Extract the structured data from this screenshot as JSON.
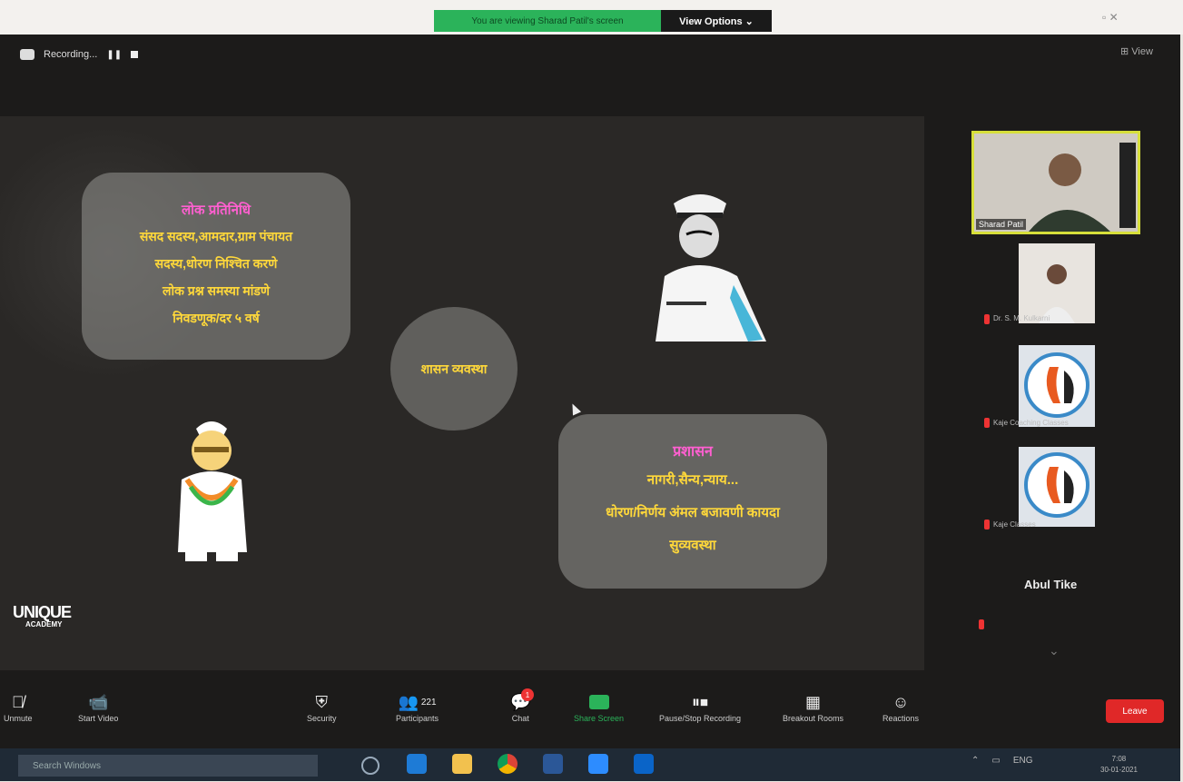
{
  "banner": {
    "sharing_msg": "You are viewing Sharad Patil's screen",
    "view_options": "View Options ⌄"
  },
  "meeting": {
    "recording_label": "Recording..."
  },
  "slide": {
    "bubble1": [
      "लोक प्रतिनिधि",
      "संसद सदस्य,आमदार,ग्राम पंचायत",
      "सदस्य,धोरण निश्चित करणे",
      "लोक प्रश्न समस्या मांडणे",
      "निवडणूक/दर ५ वर्ष"
    ],
    "center": "शासन व्यवस्था",
    "bubble2": [
      "प्रशासन",
      "नागरी,सैन्य,न्याय...",
      "धोरण/निर्णय अंमल बजावणी कायदा",
      "सुव्यवस्था"
    ],
    "logo": "UNIQUE",
    "logo_sub": "ACADEMY"
  },
  "participants": {
    "active_name": "Sharad Patil",
    "p2": "Dr. S. M. Kulkarni",
    "p3": "Kaje Coaching Classes",
    "p4": "Kaje Classes",
    "p5": "Abul Tike"
  },
  "toolbar": {
    "unmute": "Unmute",
    "start_video": "Start Video",
    "security": "Security",
    "participants": "Participants",
    "participants_count": "221",
    "chat": "Chat",
    "chat_badge": "1",
    "share": "Share Screen",
    "pause_recording": "Pause/Stop Recording",
    "breakout": "Breakout Rooms",
    "reactions": "Reactions",
    "end": "Leave"
  },
  "taskbar": {
    "search": "Search Windows",
    "lang": "ENG",
    "time": "7:08",
    "date": "30-01-2021"
  }
}
